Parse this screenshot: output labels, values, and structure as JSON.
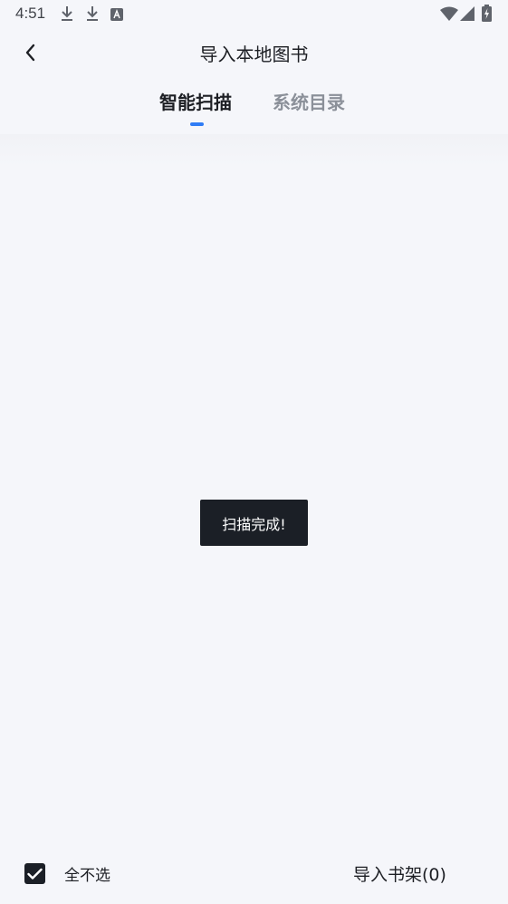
{
  "status_bar": {
    "time": "4:51",
    "left_icons": [
      "download-icon",
      "download-icon",
      "font-a-icon"
    ],
    "right_icons": [
      "wifi-icon",
      "signal-icon",
      "battery-charging-icon"
    ]
  },
  "header": {
    "back_icon": "chevron-left-icon",
    "title": "导入本地图书"
  },
  "tabs": [
    {
      "label": "智能扫描",
      "active": true
    },
    {
      "label": "系统目录",
      "active": false
    }
  ],
  "toast": {
    "text": "扫描完成!"
  },
  "bottom_bar": {
    "select_all_checked": true,
    "select_all_label": "全不选",
    "import_label": "导入书架(0)"
  },
  "colors": {
    "background": "#f5f6fa",
    "text_primary": "#1d1f24",
    "text_secondary": "#8b9099",
    "accent": "#2f7cf5",
    "toast_bg": "#1b1f26"
  }
}
